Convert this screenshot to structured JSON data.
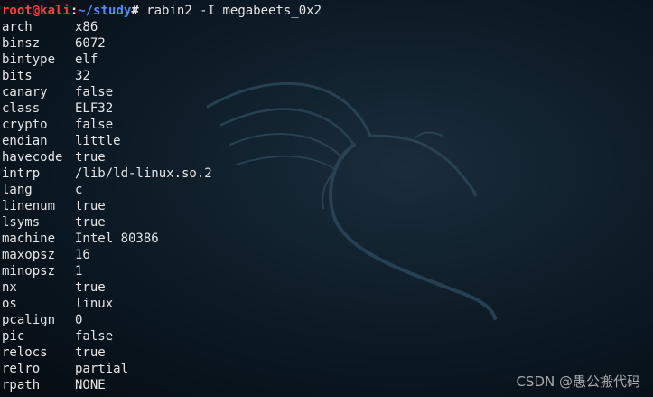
{
  "prompt": {
    "user_host": "root@kali",
    "separator": ":",
    "path": "~/study",
    "hash": "#",
    "command": " rabin2 -I megabeets_0x2"
  },
  "output": [
    {
      "key": "arch",
      "value": "x86"
    },
    {
      "key": "binsz",
      "value": "6072"
    },
    {
      "key": "bintype",
      "value": "elf"
    },
    {
      "key": "bits",
      "value": "32"
    },
    {
      "key": "canary",
      "value": "false"
    },
    {
      "key": "class",
      "value": "ELF32"
    },
    {
      "key": "crypto",
      "value": "false"
    },
    {
      "key": "endian",
      "value": "little"
    },
    {
      "key": "havecode",
      "value": "true"
    },
    {
      "key": "intrp",
      "value": "/lib/ld-linux.so.2"
    },
    {
      "key": "lang",
      "value": "c"
    },
    {
      "key": "linenum",
      "value": "true"
    },
    {
      "key": "lsyms",
      "value": "true"
    },
    {
      "key": "machine",
      "value": "Intel 80386"
    },
    {
      "key": "maxopsz",
      "value": "16"
    },
    {
      "key": "minopsz",
      "value": "1"
    },
    {
      "key": "nx",
      "value": "true"
    },
    {
      "key": "os",
      "value": "linux"
    },
    {
      "key": "pcalign",
      "value": "0"
    },
    {
      "key": "pic",
      "value": "false"
    },
    {
      "key": "relocs",
      "value": "true"
    },
    {
      "key": "relro",
      "value": "partial"
    },
    {
      "key": "rpath",
      "value": "NONE"
    }
  ],
  "watermark": "CSDN @愚公搬代码",
  "colors": {
    "background": "#0b1720",
    "prompt_user": "#ff3b3b",
    "prompt_path": "#4f8bff",
    "text": "#e6e6e6"
  },
  "icons": {
    "background_logo": "kali-dragon-logo"
  }
}
